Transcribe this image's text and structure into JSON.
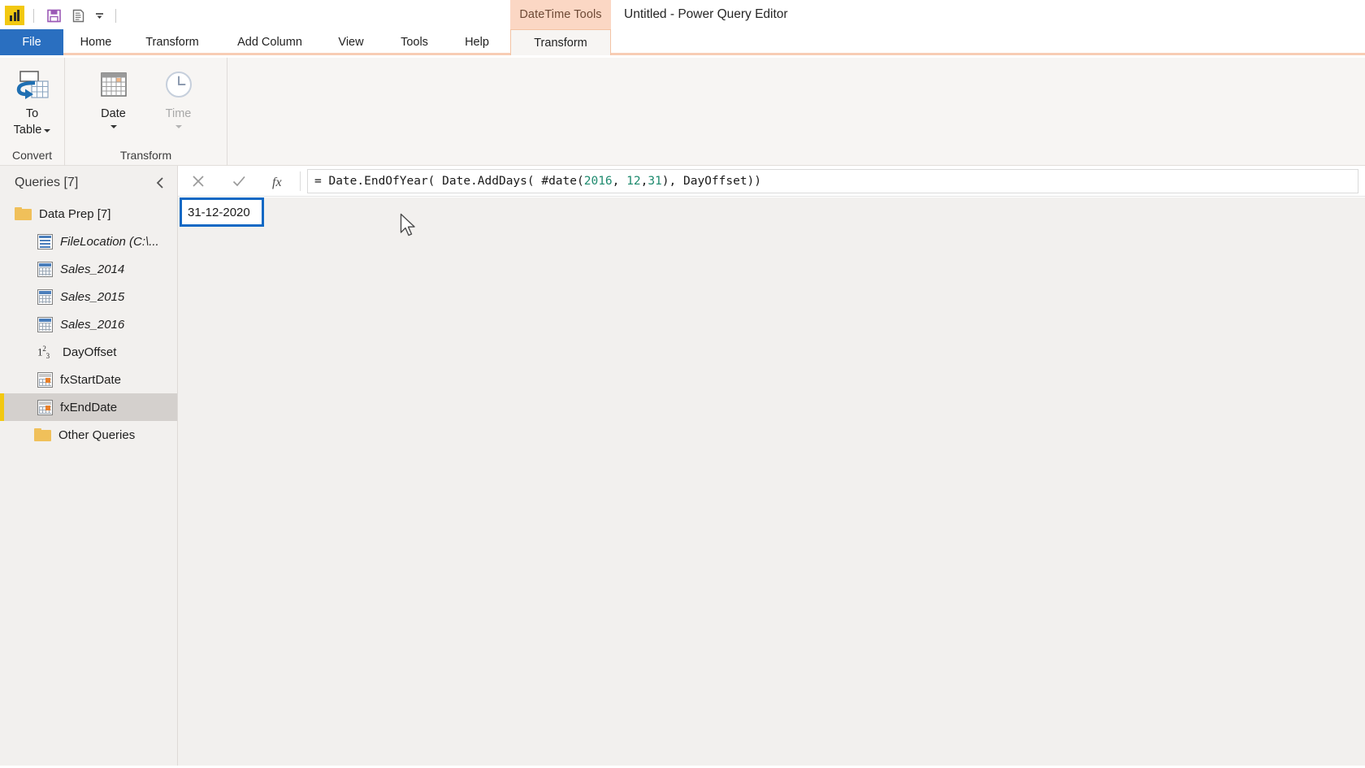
{
  "window": {
    "title": "Untitled - Power Query Editor",
    "contextual_tab_banner": "DateTime Tools"
  },
  "quick_access": {
    "logo_icon": "powerbi-logo-icon",
    "items": [
      {
        "icon": "save-icon",
        "label": "Save"
      },
      {
        "icon": "properties-icon",
        "label": "Properties"
      },
      {
        "icon": "customize-quick-access-toolbar-icon",
        "label": "Customize Quick Access Toolbar"
      }
    ]
  },
  "ribbon": {
    "tabs": [
      {
        "label": "File",
        "active": false,
        "style": "file"
      },
      {
        "label": "Home",
        "active": false,
        "style": "normal"
      },
      {
        "label": "Transform",
        "active": false,
        "style": "normal"
      },
      {
        "label": "Add Column",
        "active": false,
        "style": "normal"
      },
      {
        "label": "View",
        "active": false,
        "style": "normal"
      },
      {
        "label": "Tools",
        "active": false,
        "style": "normal"
      },
      {
        "label": "Help",
        "active": false,
        "style": "normal"
      },
      {
        "label": "Transform",
        "active": true,
        "style": "contextual"
      }
    ],
    "groups": [
      {
        "name": "Convert",
        "label": "Convert",
        "buttons": [
          {
            "label": "To\nTable",
            "label_line1": "To",
            "label_line2": "Table",
            "icon": "to-table-icon",
            "has_dropdown": true,
            "disabled": false
          }
        ]
      },
      {
        "name": "Transform",
        "label": "Transform",
        "buttons": [
          {
            "label": "Date",
            "icon": "calendar-icon",
            "has_dropdown": true,
            "disabled": false
          },
          {
            "label": "Time",
            "icon": "clock-icon",
            "has_dropdown": true,
            "disabled": true
          }
        ]
      }
    ]
  },
  "formula_bar": {
    "cancel_icon": "cancel-x-icon",
    "commit_icon": "checkmark-icon",
    "fx_icon": "fx-icon",
    "segments": [
      {
        "text": "= Date.EndOfYear( Date.AddDays( #date(",
        "type": "plain"
      },
      {
        "text": "2016",
        "type": "number"
      },
      {
        "text": ", ",
        "type": "plain"
      },
      {
        "text": "12",
        "type": "number"
      },
      {
        "text": ",",
        "type": "plain"
      },
      {
        "text": "31",
        "type": "number"
      },
      {
        "text": "), DayOffset))",
        "type": "plain"
      }
    ],
    "full_text": "= Date.EndOfYear( Date.AddDays( #date(2016, 12,31), DayOffset))"
  },
  "queries_pane": {
    "title": "Queries [7]",
    "collapse_icon": "chevron-left-icon",
    "items": [
      {
        "label": "Data Prep [7]",
        "icon": "folder-icon",
        "level": 0,
        "italic": false,
        "selected": false,
        "expanded": true
      },
      {
        "label": "FileLocation (C:\\...",
        "icon": "list-icon",
        "level": 1,
        "italic": true,
        "selected": false
      },
      {
        "label": "Sales_2014",
        "icon": "table-icon",
        "level": 1,
        "italic": true,
        "selected": false
      },
      {
        "label": "Sales_2015",
        "icon": "table-icon",
        "level": 1,
        "italic": true,
        "selected": false
      },
      {
        "label": "Sales_2016",
        "icon": "table-icon",
        "level": 1,
        "italic": true,
        "selected": false
      },
      {
        "label": "DayOffset",
        "icon": "number-123-icon",
        "level": 1,
        "italic": false,
        "selected": false
      },
      {
        "label": "fxStartDate",
        "icon": "function-icon",
        "level": 1,
        "italic": false,
        "selected": false
      },
      {
        "label": "fxEndDate",
        "icon": "function-icon",
        "level": 1,
        "italic": false,
        "selected": true
      },
      {
        "label": "Other Queries",
        "icon": "folder-icon",
        "level": 0,
        "italic": false,
        "selected": false
      }
    ]
  },
  "preview": {
    "result_value": "31-12-2020"
  },
  "colors": {
    "file_tab_blue": "#2a6fc0",
    "contextual_orange": "#fbd7c4",
    "contextual_border": "#f8cdb4",
    "selection_blue": "#1068c4",
    "accent_yellow": "#f2c811",
    "ribbon_bg": "#f7f5f3",
    "pane_bg": "#f2f0ee",
    "number_literal": "#1e8a6e"
  }
}
